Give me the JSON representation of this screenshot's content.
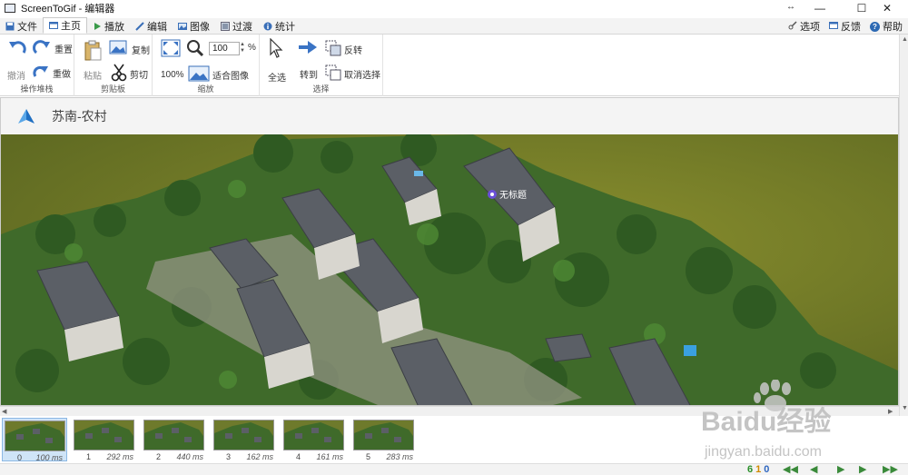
{
  "window": {
    "title": "ScreenToGif - 编辑器",
    "pin_glyph": "↔",
    "minimize": "—",
    "maximize": "☐",
    "close": "✕"
  },
  "tabs": [
    {
      "label": "文件"
    },
    {
      "label": "主页"
    },
    {
      "label": "播放"
    },
    {
      "label": "编辑"
    },
    {
      "label": "图像"
    },
    {
      "label": "过渡"
    },
    {
      "label": "统计"
    }
  ],
  "top_right": {
    "options": "选项",
    "feedback": "反馈",
    "help": "帮助"
  },
  "ribbon": {
    "undo_stack": {
      "undo": "撤消",
      "redo": "重做",
      "reset": "重置",
      "group": "操作堆栈"
    },
    "clipboard": {
      "paste": "粘贴",
      "copy": "复制",
      "cut": "剪切",
      "group": "剪贴板"
    },
    "zoom": {
      "value": "100",
      "unit": "%",
      "percent_btn": "100%",
      "fit": "适合图像",
      "group": "缩放"
    },
    "selection": {
      "select_all": "全选",
      "goto": "转到",
      "invert": "反转",
      "deselect": "取消选择",
      "group": "选择"
    }
  },
  "map": {
    "title": "苏南-农村",
    "marker_label": "无标题"
  },
  "frames": [
    {
      "index": "0",
      "ms": "100 ms"
    },
    {
      "index": "1",
      "ms": "292 ms"
    },
    {
      "index": "2",
      "ms": "440 ms"
    },
    {
      "index": "3",
      "ms": "162 ms"
    },
    {
      "index": "4",
      "ms": "161 ms"
    },
    {
      "index": "5",
      "ms": "283 ms"
    }
  ],
  "status": {
    "total": "6",
    "selected": "1",
    "other": "0"
  },
  "watermark": {
    "text": "Baidu经验",
    "url": "jingyan.baidu.com"
  },
  "colors": {
    "accent": "#2c69b3",
    "field": "#6e7a2c",
    "roof": "#5b5f66"
  }
}
